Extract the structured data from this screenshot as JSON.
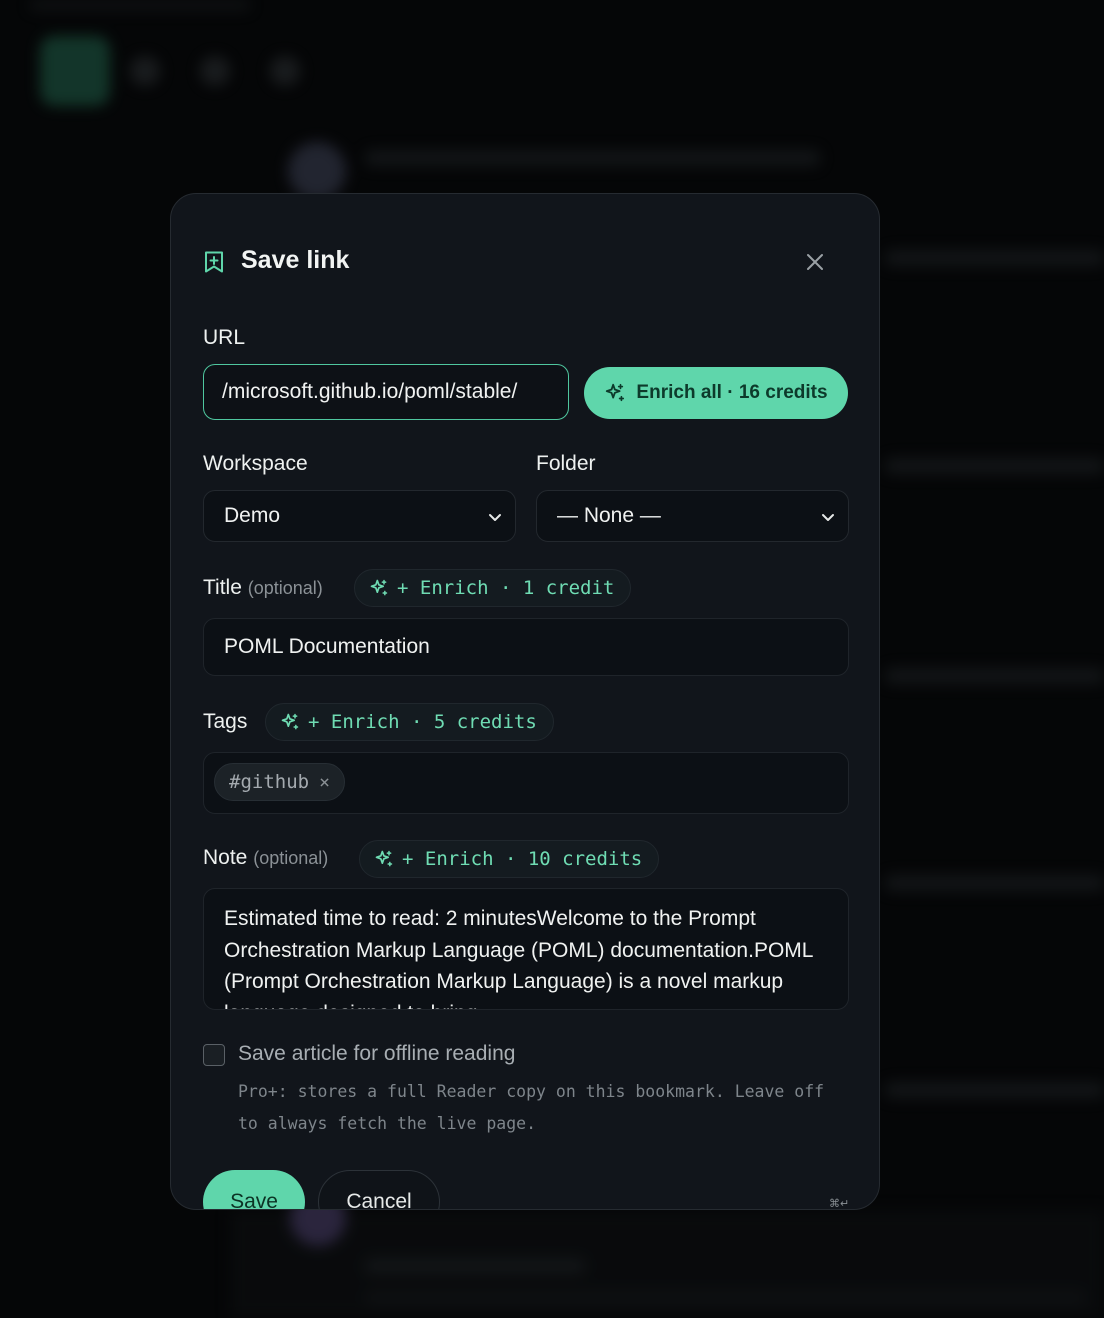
{
  "dialog": {
    "title": "Save link",
    "url_label": "URL",
    "url_value": "/microsoft.github.io/poml/stable/",
    "enrich_all_label": "Enrich all · 16 credits",
    "workspace_label": "Workspace",
    "workspace_value": "Demo",
    "folder_label": "Folder",
    "folder_value": "— None —",
    "title_label": "Title",
    "title_optional": "(optional)",
    "title_enrich": "+ Enrich · 1 credit",
    "title_value": "POML Documentation",
    "tags_label": "Tags",
    "tags_enrich": "+ Enrich · 5 credits",
    "tags": [
      "#github"
    ],
    "note_label": "Note",
    "note_optional": "(optional)",
    "note_enrich": "+ Enrich · 10 credits",
    "note_value": "Estimated time to read: 2 minutesWelcome to the Prompt Orchestration Markup Language (POML) documentation.POML (Prompt Orchestration Markup Language) is a novel markup language designed to bring",
    "offline_label": "Save article for offline reading",
    "offline_hint": "Pro+: stores a full Reader copy on this bookmark. Leave off to always fetch the live page.",
    "save_label": "Save",
    "cancel_label": "Cancel",
    "shortcut": "⌘↵"
  },
  "icons": {
    "header": "bookmark-plus-icon",
    "close": "close-icon",
    "sparkle": "sparkles-icon",
    "chevron": "chevron-down-icon"
  },
  "colors": {
    "accent": "#5fd6ab",
    "accent_text": "#6fdcb3",
    "modal_bg": "#11151b",
    "page_bg": "#050607"
  }
}
